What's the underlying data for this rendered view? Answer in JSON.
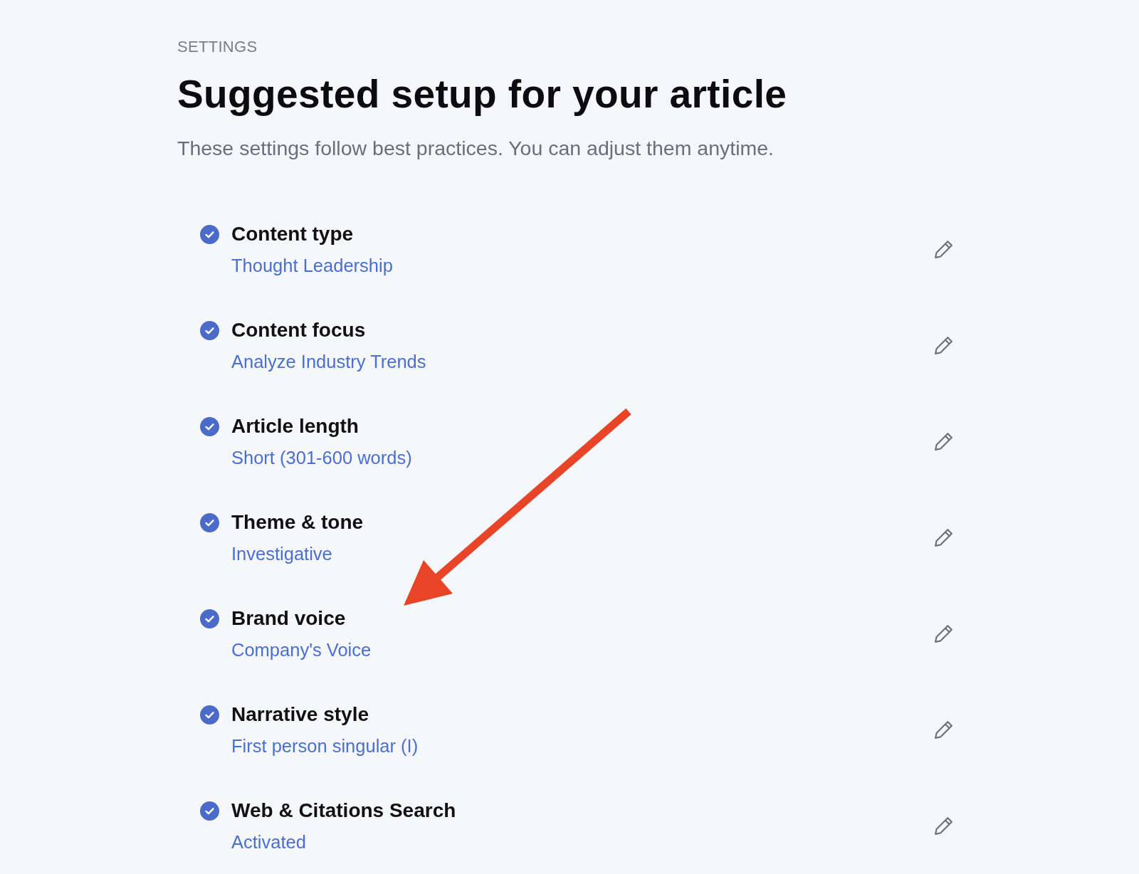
{
  "header": {
    "eyebrow": "SETTINGS",
    "title": "Suggested setup for your article",
    "subtitle": "These settings follow best practices. You can adjust them anytime."
  },
  "settings": [
    {
      "label": "Content type",
      "value": "Thought Leadership",
      "checked": true
    },
    {
      "label": "Content focus",
      "value": "Analyze Industry Trends",
      "checked": true
    },
    {
      "label": "Article length",
      "value": "Short (301-600 words)",
      "checked": true
    },
    {
      "label": "Theme & tone",
      "value": "Investigative",
      "checked": true
    },
    {
      "label": "Brand voice",
      "value": "Company's Voice",
      "checked": true
    },
    {
      "label": "Narrative style",
      "value": "First person singular (I)",
      "checked": true
    },
    {
      "label": "Web & Citations Search",
      "value": "Activated",
      "checked": true
    }
  ],
  "annotations": [
    {
      "kind": "arrow"
    }
  ]
}
